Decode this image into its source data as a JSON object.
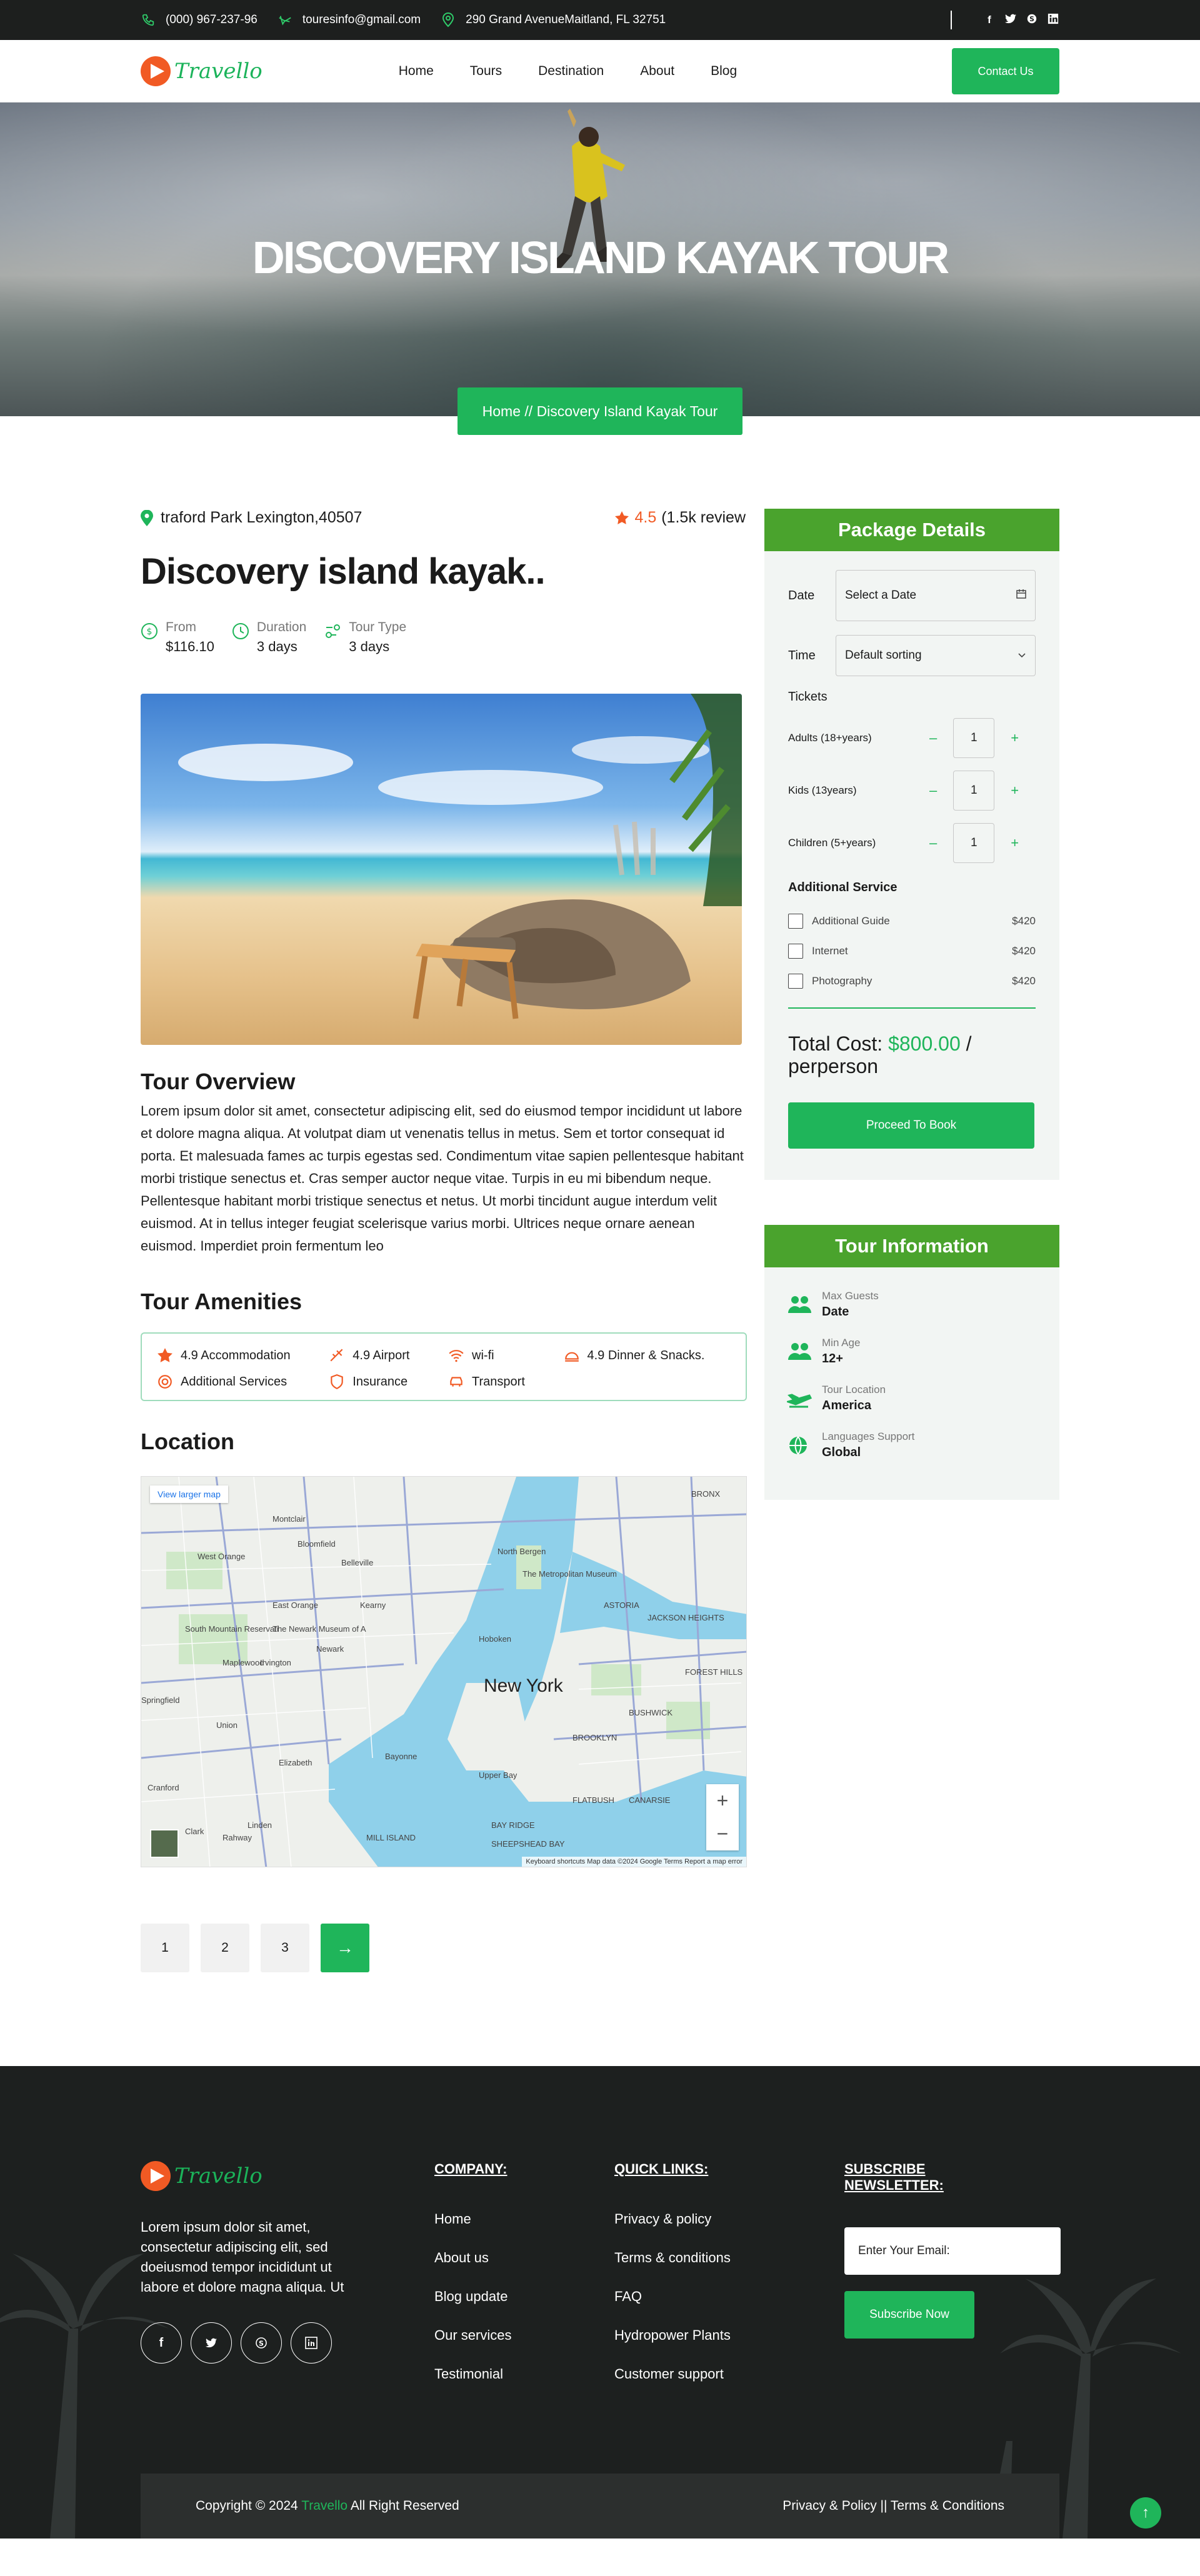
{
  "topbar": {
    "phone": "(000) 967-237-96",
    "email": "touresinfo@gmail.com",
    "address": "290 Grand AvenueMaitland, FL 32751",
    "social": [
      "facebook-icon",
      "twitter-icon",
      "skype-icon",
      "linkedin-icon"
    ]
  },
  "nav": {
    "logo": "Travello",
    "items": [
      "Home",
      "Tours",
      "Destination",
      "About",
      "Blog"
    ],
    "contact": "Contact Us"
  },
  "hero": {
    "title": "DISCOVERY ISLAND KAYAK TOUR",
    "breadcrumb": "Home // Discovery Island Kayak Tour"
  },
  "tour": {
    "location": "traford Park Lexington,40507",
    "rating": "4.5",
    "reviews": "(1.5k review",
    "title": "Discovery island kayak..",
    "meta": [
      {
        "label": "From",
        "value": "$116.10"
      },
      {
        "label": "Duration",
        "value": "3 days"
      },
      {
        "label": "Tour Type",
        "value": "3 days"
      }
    ],
    "overview_title": "Tour Overview",
    "overview": "Lorem ipsum dolor sit amet, consectetur adipiscing elit, sed do eiusmod tempor incididunt ut labore et dolore magna aliqua. At volutpat diam ut venenatis tellus in metus. Sem et tortor consequat id porta. Et malesuada fames ac turpis egestas sed. Condimentum vitae sapien pellentesque habitant morbi tristique senectus et. Cras semper auctor neque vitae. Turpis in eu mi bibendum neque. Pellentesque habitant morbi tristique senectus et netus. Ut morbi tincidunt augue interdum velit euismod. At in tellus integer feugiat scelerisque varius morbi. Ultrices neque ornare aenean euismod. Imperdiet proin fermentum leo",
    "amenities_title": "Tour Amenities",
    "amenities": [
      {
        "label": "4.9 Accommodation",
        "icon": "star-icon"
      },
      {
        "label": "4.9 Airport",
        "icon": "plane-icon"
      },
      {
        "label": "wi-fi",
        "icon": "wifi-icon"
      },
      {
        "label": "4.9 Dinner & Snacks.",
        "icon": "dinner-icon"
      },
      {
        "label": "Additional Services",
        "icon": "service-icon"
      },
      {
        "label": "Insurance",
        "icon": "shield-icon"
      },
      {
        "label": "Transport",
        "icon": "car-icon"
      }
    ],
    "location_title": "Location"
  },
  "map": {
    "larger_link": "View larger map",
    "city": "New York",
    "labels": [
      "Montclair",
      "Bloomfield",
      "Belleville",
      "West Orange",
      "North Bergen",
      "The Metropolitan Museum of Art",
      "East Orange",
      "Kearny",
      "ASTORIA",
      "JACKSON HEIGHTS",
      "South Mountain Reservation",
      "The Newark Museum of Art",
      "Newark",
      "Hoboken",
      "Maplewood",
      "Irvington",
      "FOREST HILLS",
      "Springfield",
      "Union",
      "BUSHWICK",
      "Elizabeth",
      "BROOKLYN",
      "Cranford",
      "Bayonne",
      "Linden",
      "FLATBUSH",
      "CANARSIE",
      "BAY RIDGE",
      "Clark",
      "Rahway",
      "MILL ISLAND",
      "SHEEPSHEAD BAY",
      "BRONX",
      "Upper Bay"
    ],
    "footer": "Keyboard shortcuts   Map data ©2024 Google   Terms   Report a map error"
  },
  "pagination": [
    "1",
    "2",
    "3"
  ],
  "package": {
    "title": "Package Details",
    "date_label": "Date",
    "date_placeholder": "Select a Date",
    "time_label": "Time",
    "time_value": "Default sorting",
    "tickets_title": "Tickets",
    "tickets": [
      {
        "label": "Adults (18+years)",
        "qty": "1"
      },
      {
        "label": "Kids (13years)",
        "qty": "1"
      },
      {
        "label": "Children (5+years)",
        "qty": "1"
      }
    ],
    "services_title": "Additional Service",
    "services": [
      {
        "label": "Additional Guide",
        "price": "$420"
      },
      {
        "label": "Internet",
        "price": "$420"
      },
      {
        "label": "Photography",
        "price": "$420"
      }
    ],
    "total_label": "Total Cost:",
    "total_amount": "$800.00",
    "total_suffix": "/ perperson",
    "book": "Proceed To Book"
  },
  "info": {
    "title": "Tour Information",
    "rows": [
      {
        "label": "Max Guests",
        "value": "Date"
      },
      {
        "label": "Min Age",
        "value": "12+"
      },
      {
        "label": "Tour Location",
        "value": "America"
      },
      {
        "label": "Languages Support",
        "value": "Global"
      }
    ]
  },
  "footer": {
    "logo": "Travello",
    "desc": "Lorem ipsum dolor sit amet, consectetur adipiscing elit, sed doeiusmod tempor incididunt ut labore et dolore magna aliqua. Ut",
    "company_title": "COMPANY:",
    "company": [
      "Home",
      "About us",
      "Blog update",
      "Our services",
      "Testimonial"
    ],
    "quick_title": "QUICK LINKS:",
    "quick": [
      "Privacy & policy",
      "Terms & conditions",
      "FAQ",
      "Hydropower Plants",
      "Customer support"
    ],
    "newsletter_title": "SUBSCRIBE NEWSLETTER:",
    "email_placeholder": "Enter Your Email:",
    "subscribe": "Subscribe Now",
    "copyright_pre": "Copyright © 2024",
    "copyright_brand": "Travello",
    "copyright_post": "All Right Reserved",
    "legal": "Privacy & Policy || Terms & Conditions"
  },
  "colors": {
    "accent": "#1fb55a",
    "header_green": "#4aa32d",
    "brand_orange": "#f15a24",
    "dark": "#1d1f1e"
  }
}
